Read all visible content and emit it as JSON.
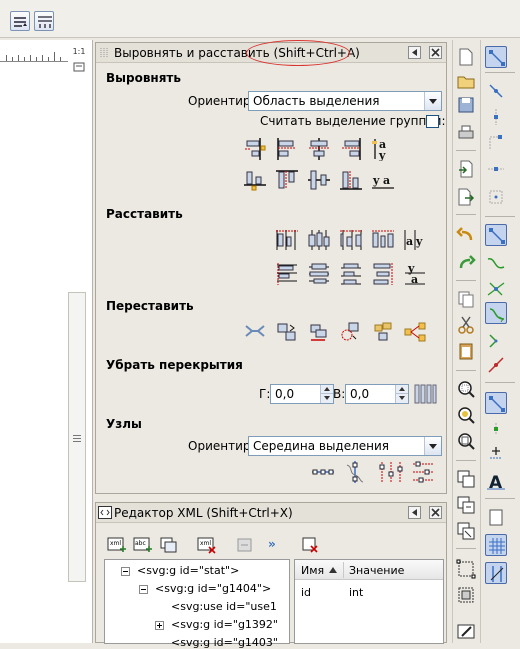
{
  "panel": {
    "title": "Выровнять и расставить (Shift+Ctrl+A)",
    "align": {
      "heading": "Выровнять",
      "relative_label": "Ориентир:",
      "relative_value": "Область выделения",
      "group_checkbox_label": "Считать выделение группой:",
      "group_checked": false
    },
    "distribute": {
      "heading": "Расставить"
    },
    "rearrange": {
      "heading": "Переставить"
    },
    "remove_overlaps": {
      "heading": "Убрать перекрытия",
      "h_label": "Г:",
      "h_value": "0,0",
      "v_label": "В:",
      "v_value": "0,0"
    },
    "nodes": {
      "heading": "Узлы",
      "relative_label": "Ориентир:",
      "relative_value": "Середина выделения"
    }
  },
  "xml_editor": {
    "title": "Редактор XML (Shift+Ctrl+X)",
    "more_label": "»",
    "tree": [
      {
        "text": "<svg:g id=\"stat\">"
      },
      {
        "text": "<svg:g id=\"g1404\">"
      },
      {
        "text": "<svg:use id=\"use1"
      },
      {
        "text": "<svg:g id=\"g1392\""
      },
      {
        "text": "<svg:g id=\"g1403\""
      }
    ],
    "attr_columns": {
      "name": "Имя",
      "value": "Значение"
    },
    "attrs": [
      {
        "name": "id",
        "value": "int"
      }
    ]
  },
  "canvas": {
    "zoom_label": "1:1"
  },
  "colors": {
    "highlight_ellipse": "#d9332e",
    "active_button": "#c4d3ee",
    "accent_blue": "#3a6fc4"
  }
}
